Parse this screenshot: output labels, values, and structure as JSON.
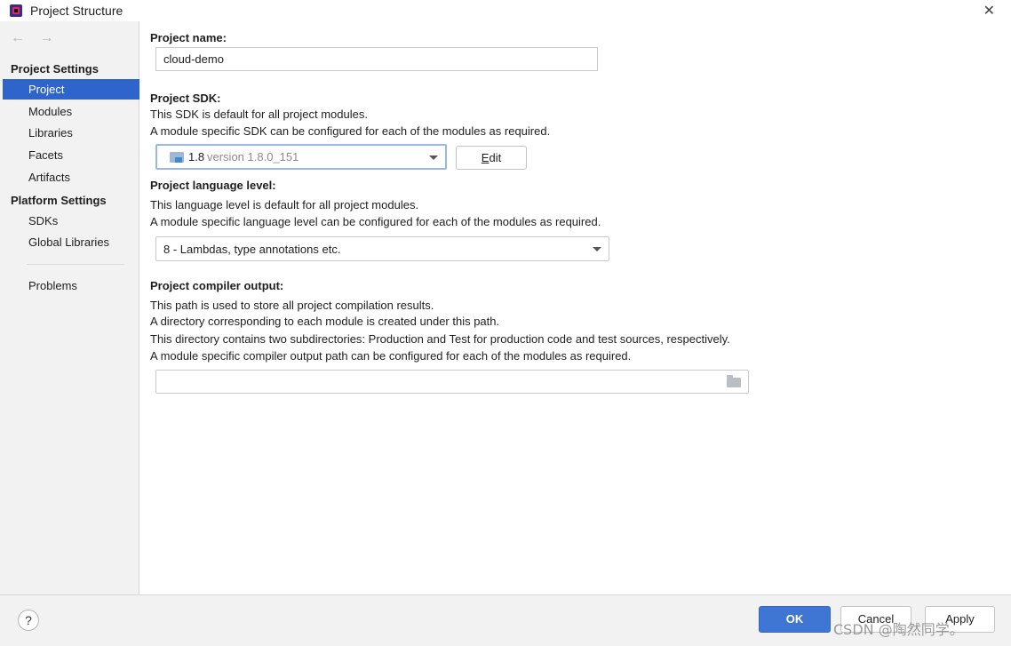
{
  "window": {
    "title": "Project Structure",
    "close_glyph": "✕",
    "app_icon": "intellij-idea-icon"
  },
  "sidebar": {
    "back_arrow": "←",
    "forward_arrow": "→",
    "project_settings_heading": "Project Settings",
    "platform_settings_heading": "Platform Settings",
    "items": [
      {
        "label": "Project",
        "selected": true
      },
      {
        "label": "Modules"
      },
      {
        "label": "Libraries"
      },
      {
        "label": "Facets"
      },
      {
        "label": "Artifacts"
      }
    ],
    "platform_items": [
      {
        "label": "SDKs"
      },
      {
        "label": "Global Libraries"
      }
    ],
    "problems": "Problems"
  },
  "project_name": {
    "label": "Project name:",
    "value": "cloud-demo"
  },
  "project_sdk": {
    "label": "Project SDK:",
    "desc1": "This SDK is default for all project modules.",
    "desc2": "A module specific SDK can be configured for each of the modules as required.",
    "selected_name": "1.8",
    "selected_version": "version 1.8.0_151",
    "sdk_icon": "folder-jdk-icon",
    "edit_prefix": "E",
    "edit_rest": "dit"
  },
  "language_level": {
    "label": "Project language level:",
    "desc1": "This language level is default for all project modules.",
    "desc2": "A module specific language level can be configured for each of the modules as required.",
    "selected": "8 - Lambdas, type annotations etc."
  },
  "compiler_output": {
    "label": "Project compiler output:",
    "desc1": "This path is used to store all project compilation results.",
    "desc2": "A directory corresponding to each module is created under this path.",
    "desc3": "This directory contains two subdirectories: Production and Test for production code and test sources, respectively.",
    "desc4": "A module specific compiler output path can be configured for each of the modules as required.",
    "value": "",
    "browse_icon": "folder-icon"
  },
  "footer": {
    "help": "?",
    "ok": "OK",
    "cancel": "Cancel",
    "apply": "Apply"
  },
  "watermark": "CSDN @陶然同学。"
}
